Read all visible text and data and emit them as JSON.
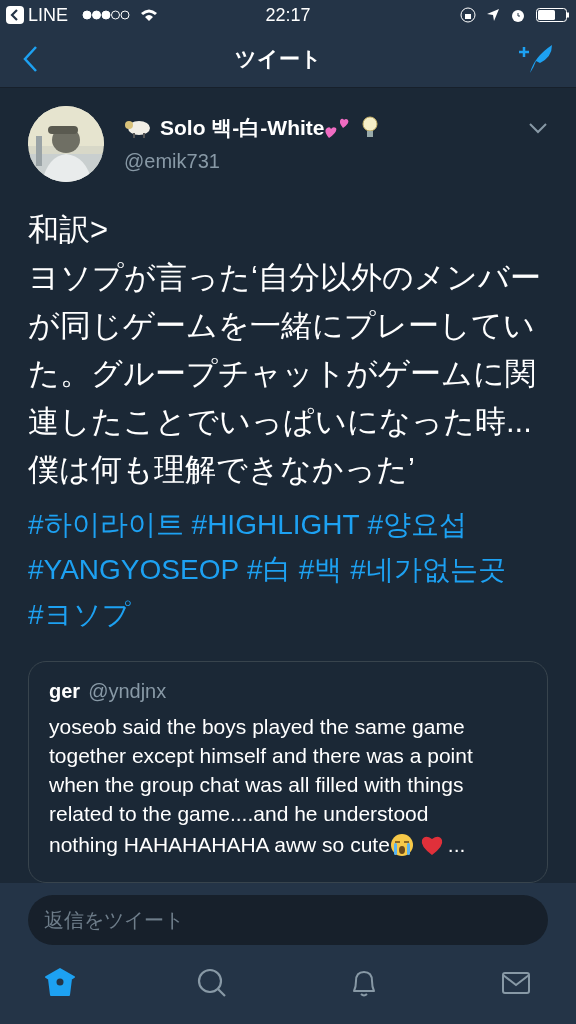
{
  "status_bar": {
    "back_app": "LINE",
    "time": "22:17"
  },
  "nav": {
    "title": "ツイート"
  },
  "tweet": {
    "name": "Solo 백-白-White",
    "handle": "@emik731",
    "text": "和訳>\nヨソプが言った‘自分以外のメンバーが同じゲームを一緒にプレーしていた。グループチャットがゲームに関連したことでいっぱいになった時...僕は何も理解できなかった’",
    "hashtags": [
      "#하이라이트",
      "#HIGHLIGHT",
      "#양요섭",
      "#YANGYOSEOP",
      "#白",
      "#백",
      "#네가없는곳",
      "#ヨソプ"
    ],
    "quote": {
      "name": "ger",
      "handle": "@yndjnx",
      "lines": [
        "yoseob said the boys played the same game",
        "together except himself and there was a point",
        "when the group chat was all filled with things",
        "related to the game....and he understood"
      ],
      "last_line": "nothing HAHAHAHAHA aww so cute",
      "ellipsis": "..."
    }
  },
  "reply": {
    "placeholder": "返信をツイート"
  },
  "tabs": [
    {
      "kind": "home",
      "selected": true
    },
    {
      "kind": "search",
      "selected": false
    },
    {
      "kind": "notifications",
      "selected": false
    },
    {
      "kind": "messages",
      "selected": false
    }
  ]
}
